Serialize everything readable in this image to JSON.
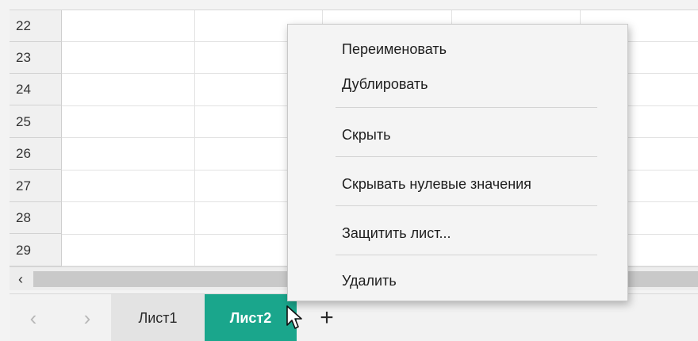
{
  "grid": {
    "rows": [
      "22",
      "23",
      "24",
      "25",
      "26",
      "27",
      "28",
      "29"
    ]
  },
  "scrollbar": {
    "left_arrow": "‹"
  },
  "tabbar": {
    "prev_arrow": "‹",
    "next_arrow": "›",
    "sheets": [
      {
        "label": "Лист1",
        "active": false
      },
      {
        "label": "Лист2",
        "active": true
      }
    ],
    "add_label": "+"
  },
  "context_menu": {
    "items": [
      "Переименовать",
      "Дублировать",
      "Скрыть",
      "Скрывать нулевые значения",
      "Защитить лист...",
      "Удалить"
    ]
  },
  "colors": {
    "active_tab": "#1aa68c",
    "menu_bg": "#f4f4f4"
  }
}
